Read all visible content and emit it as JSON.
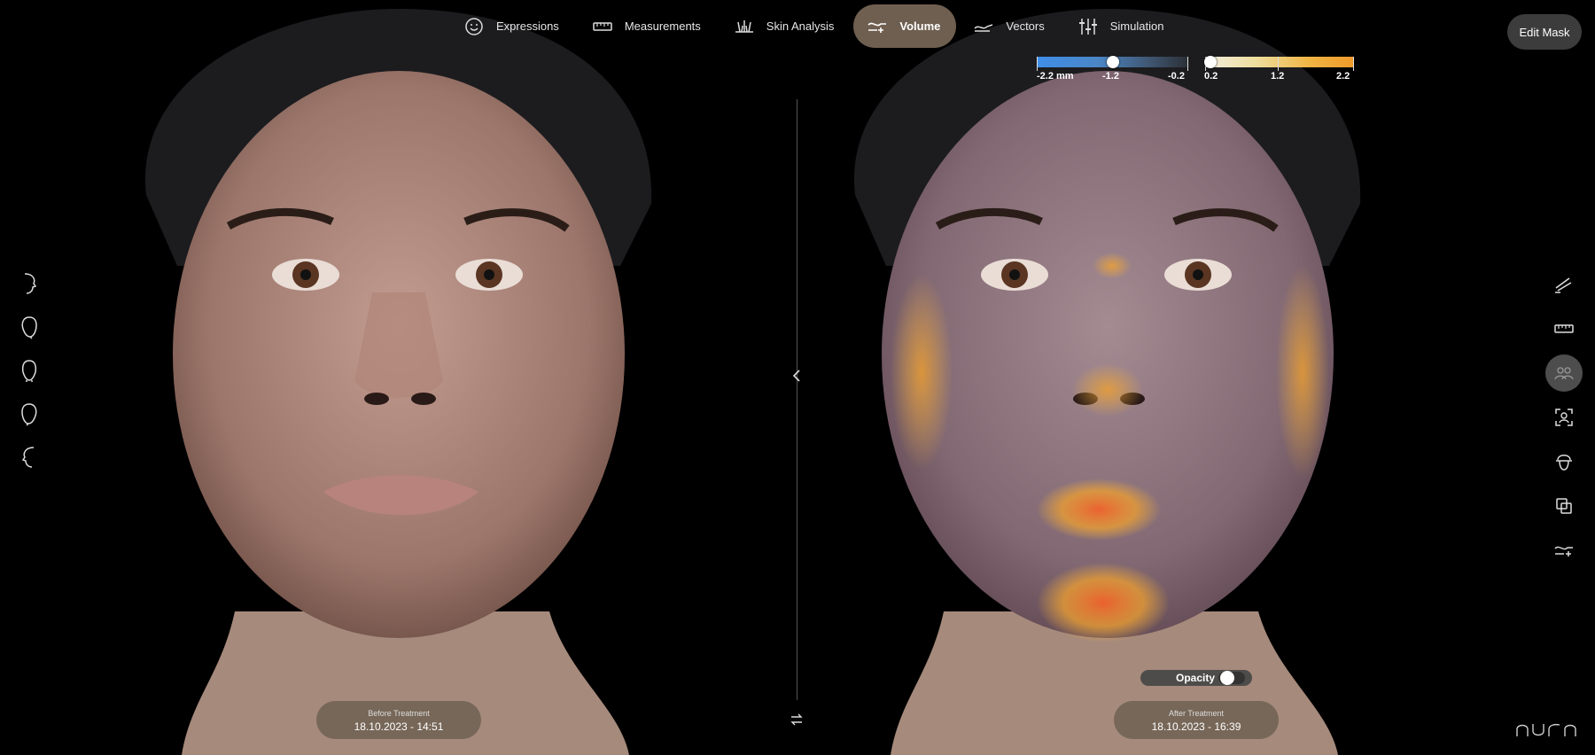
{
  "nav": {
    "items": [
      {
        "label": "Expressions",
        "icon": "smiley-icon"
      },
      {
        "label": "Measurements",
        "icon": "ruler-icon"
      },
      {
        "label": "Skin Analysis",
        "icon": "skin-analysis-icon"
      },
      {
        "label": "Volume",
        "icon": "volume-icon",
        "active": true
      },
      {
        "label": "Vectors",
        "icon": "vectors-icon"
      },
      {
        "label": "Simulation",
        "icon": "sliders-icon"
      }
    ]
  },
  "edit_mask_label": "Edit Mask",
  "legend": {
    "negative_labels": [
      "-2.2 mm",
      "-1.2",
      "-0.2"
    ],
    "positive_labels": [
      "0.2",
      "1.2",
      "2.2"
    ],
    "negative_threshold": -1.2,
    "positive_threshold": 0.2,
    "negative_colors": [
      "#3f8ee8",
      "#2b2f36"
    ],
    "positive_colors": [
      "#f2ede0",
      "#f19a2a"
    ]
  },
  "before": {
    "caption": "Before Treatment",
    "date": "18.10.2023 - 14:51"
  },
  "after": {
    "caption": "After Treatment",
    "date": "18.10.2023 - 16:39"
  },
  "opacity": {
    "label": "Opacity",
    "enabled": false
  },
  "left_tools": [
    "profile-right-icon",
    "oblique-right-icon",
    "front-face-icon",
    "oblique-left-icon",
    "profile-left-icon"
  ],
  "right_tools": [
    {
      "icon": "brush-icon"
    },
    {
      "icon": "ruler-tool-icon"
    },
    {
      "icon": "compare-faces-icon",
      "active": true
    },
    {
      "icon": "face-scan-icon"
    },
    {
      "icon": "head-view-icon"
    },
    {
      "icon": "copy-icon"
    },
    {
      "icon": "volume-tool-icon"
    }
  ],
  "brand": "AURA"
}
